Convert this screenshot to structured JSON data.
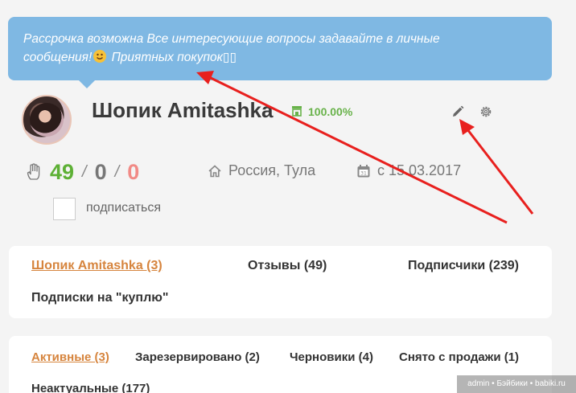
{
  "banner": {
    "line1": "Рассрочка возможна Все интересующие вопросы задавайте в личные",
    "line2_pre": "сообщения!",
    "line2_post": " Приятных покупок",
    "boxes": "▯▯"
  },
  "shop": {
    "title": "Шопик Amitashka",
    "rating": "100.00%"
  },
  "stats": {
    "positive": "49",
    "sep1": "/",
    "neutral": "0",
    "sep2": "/",
    "negative": "0"
  },
  "location": "Россия, Тула",
  "since": "с 15.03.2017",
  "subscribe_label": "подписаться",
  "profile_tabs": {
    "shop": "Шопик Amitashka (3)",
    "reviews": "Отзывы (49)",
    "subscribers": "Подписчики (239)",
    "buy_subscriptions": "Подписки на \"куплю\""
  },
  "listing_tabs": {
    "active": "Активные (3)",
    "reserved": "Зарезервировано (2)",
    "drafts": "Черновики (4)",
    "removed": "Снято с продажи (1)",
    "irrelevant": "Неактуальные (177)"
  },
  "watermark": "admin • Бэйбики • babiki.ru",
  "colors": {
    "banner": "#7fb8e3",
    "positive": "#5db035",
    "negative": "#f18a86",
    "accent": "#d6843d",
    "annotation_arrow": "#e8201e"
  }
}
